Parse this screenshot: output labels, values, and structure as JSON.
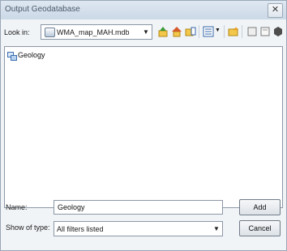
{
  "window": {
    "title": "Output Geodatabase",
    "close_glyph": "✕"
  },
  "toolbar": {
    "lookin_label": "Look in:",
    "lookin_value": "WMA_map_MAH.mdb",
    "icons": [
      "up-one-level-icon",
      "home-icon",
      "connect-folder-icon",
      "view-menu-icon",
      "new-folder-icon",
      "delete-icon",
      "refresh-icon",
      "options-icon"
    ]
  },
  "list": {
    "items": [
      {
        "name": "Geology",
        "icon": "feature-class-icon"
      }
    ]
  },
  "form": {
    "name_label": "Name:",
    "name_value": "Geology",
    "type_label": "Show of type:",
    "type_value": "All filters listed",
    "add_label": "Add",
    "cancel_label": "Cancel"
  }
}
